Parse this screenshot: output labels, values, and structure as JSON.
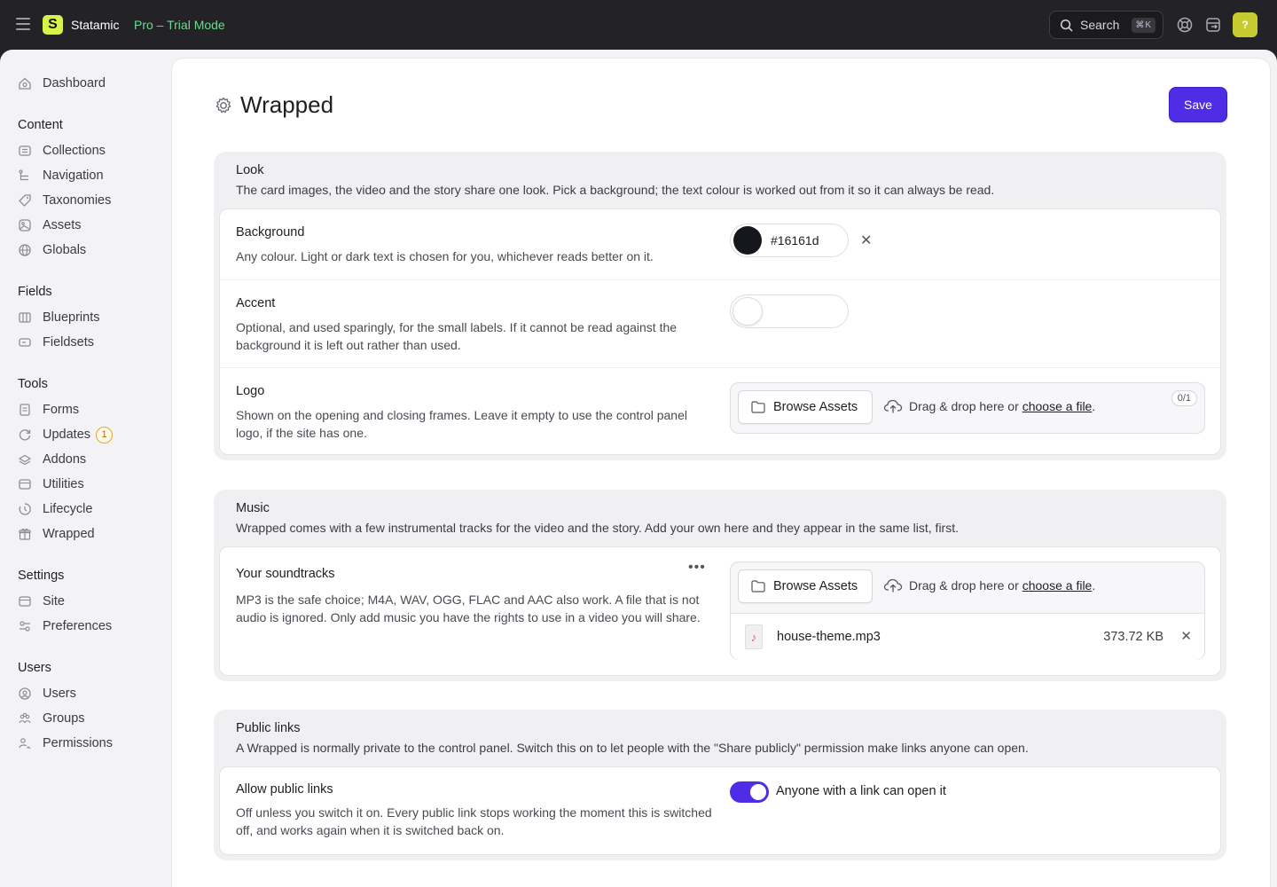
{
  "topbar": {
    "brand": "Statamic",
    "logo_letter": "S",
    "edition": "Pro – Trial Mode",
    "search_label": "Search",
    "search_shortcut": "⌘K",
    "avatar_initial": "?"
  },
  "sidebar": {
    "dashboard": "Dashboard",
    "groups": [
      {
        "heading": "Content",
        "items": [
          "Collections",
          "Navigation",
          "Taxonomies",
          "Assets",
          "Globals"
        ]
      },
      {
        "heading": "Fields",
        "items": [
          "Blueprints",
          "Fieldsets"
        ]
      },
      {
        "heading": "Tools",
        "items": [
          "Forms",
          "Updates",
          "Addons",
          "Utilities",
          "Lifecycle",
          "Wrapped"
        ]
      },
      {
        "heading": "Settings",
        "items": [
          "Site",
          "Preferences"
        ]
      },
      {
        "heading": "Users",
        "items": [
          "Users",
          "Groups",
          "Permissions"
        ]
      }
    ],
    "updates_badge": "1"
  },
  "page": {
    "title": "Wrapped",
    "save_label": "Save"
  },
  "look": {
    "title": "Look",
    "description": "The card images, the video and the story share one look. Pick a background; the text colour is worked out from it so it can always be read.",
    "background": {
      "label": "Background",
      "help": "Any colour. Light or dark text is chosen for you, whichever reads better on it.",
      "value": "#16161d"
    },
    "accent": {
      "label": "Accent",
      "help": "Optional, and used sparingly, for the small labels. If it cannot be read against the background it is left out rather than used."
    },
    "logo": {
      "label": "Logo",
      "help": "Shown on the opening and closing frames. Leave it empty to use the control panel logo, if the site has one.",
      "browse_label": "Browse Assets",
      "drop_text": "Drag & drop here or",
      "choose_link": "choose a file",
      "drop_suffix": ".",
      "count": "0/1"
    }
  },
  "music": {
    "title": "Music",
    "description": "Wrapped comes with a few instrumental tracks for the video and the story. Add your own here and they appear in the same list, first.",
    "soundtracks": {
      "label": "Your soundtracks",
      "help": "MP3 is the safe choice; M4A, WAV, OGG, FLAC and AAC also work. A file that is not audio is ignored. Only add music you have the rights to use in a video you will share.",
      "browse_label": "Browse Assets",
      "drop_text": "Drag & drop here or",
      "choose_link": "choose a file",
      "drop_suffix": ".",
      "file_name": "house-theme.mp3",
      "file_size": "373.72 KB"
    }
  },
  "public_links": {
    "title": "Public links",
    "description": "A Wrapped is normally private to the control panel. Switch this on to let people with the \"Share publicly\" permission make links anyone can open.",
    "allow": {
      "label": "Allow public links",
      "help": "Off unless you switch it on. Every public link stops working the moment this is switched off, and works again when it is switched back on.",
      "toggle_label": "Anyone with a link can open it",
      "enabled": true
    }
  },
  "colors": {
    "accent": "#4f2de6",
    "brand_logo": "#d9f24b",
    "trial_text": "#6fd98f"
  }
}
